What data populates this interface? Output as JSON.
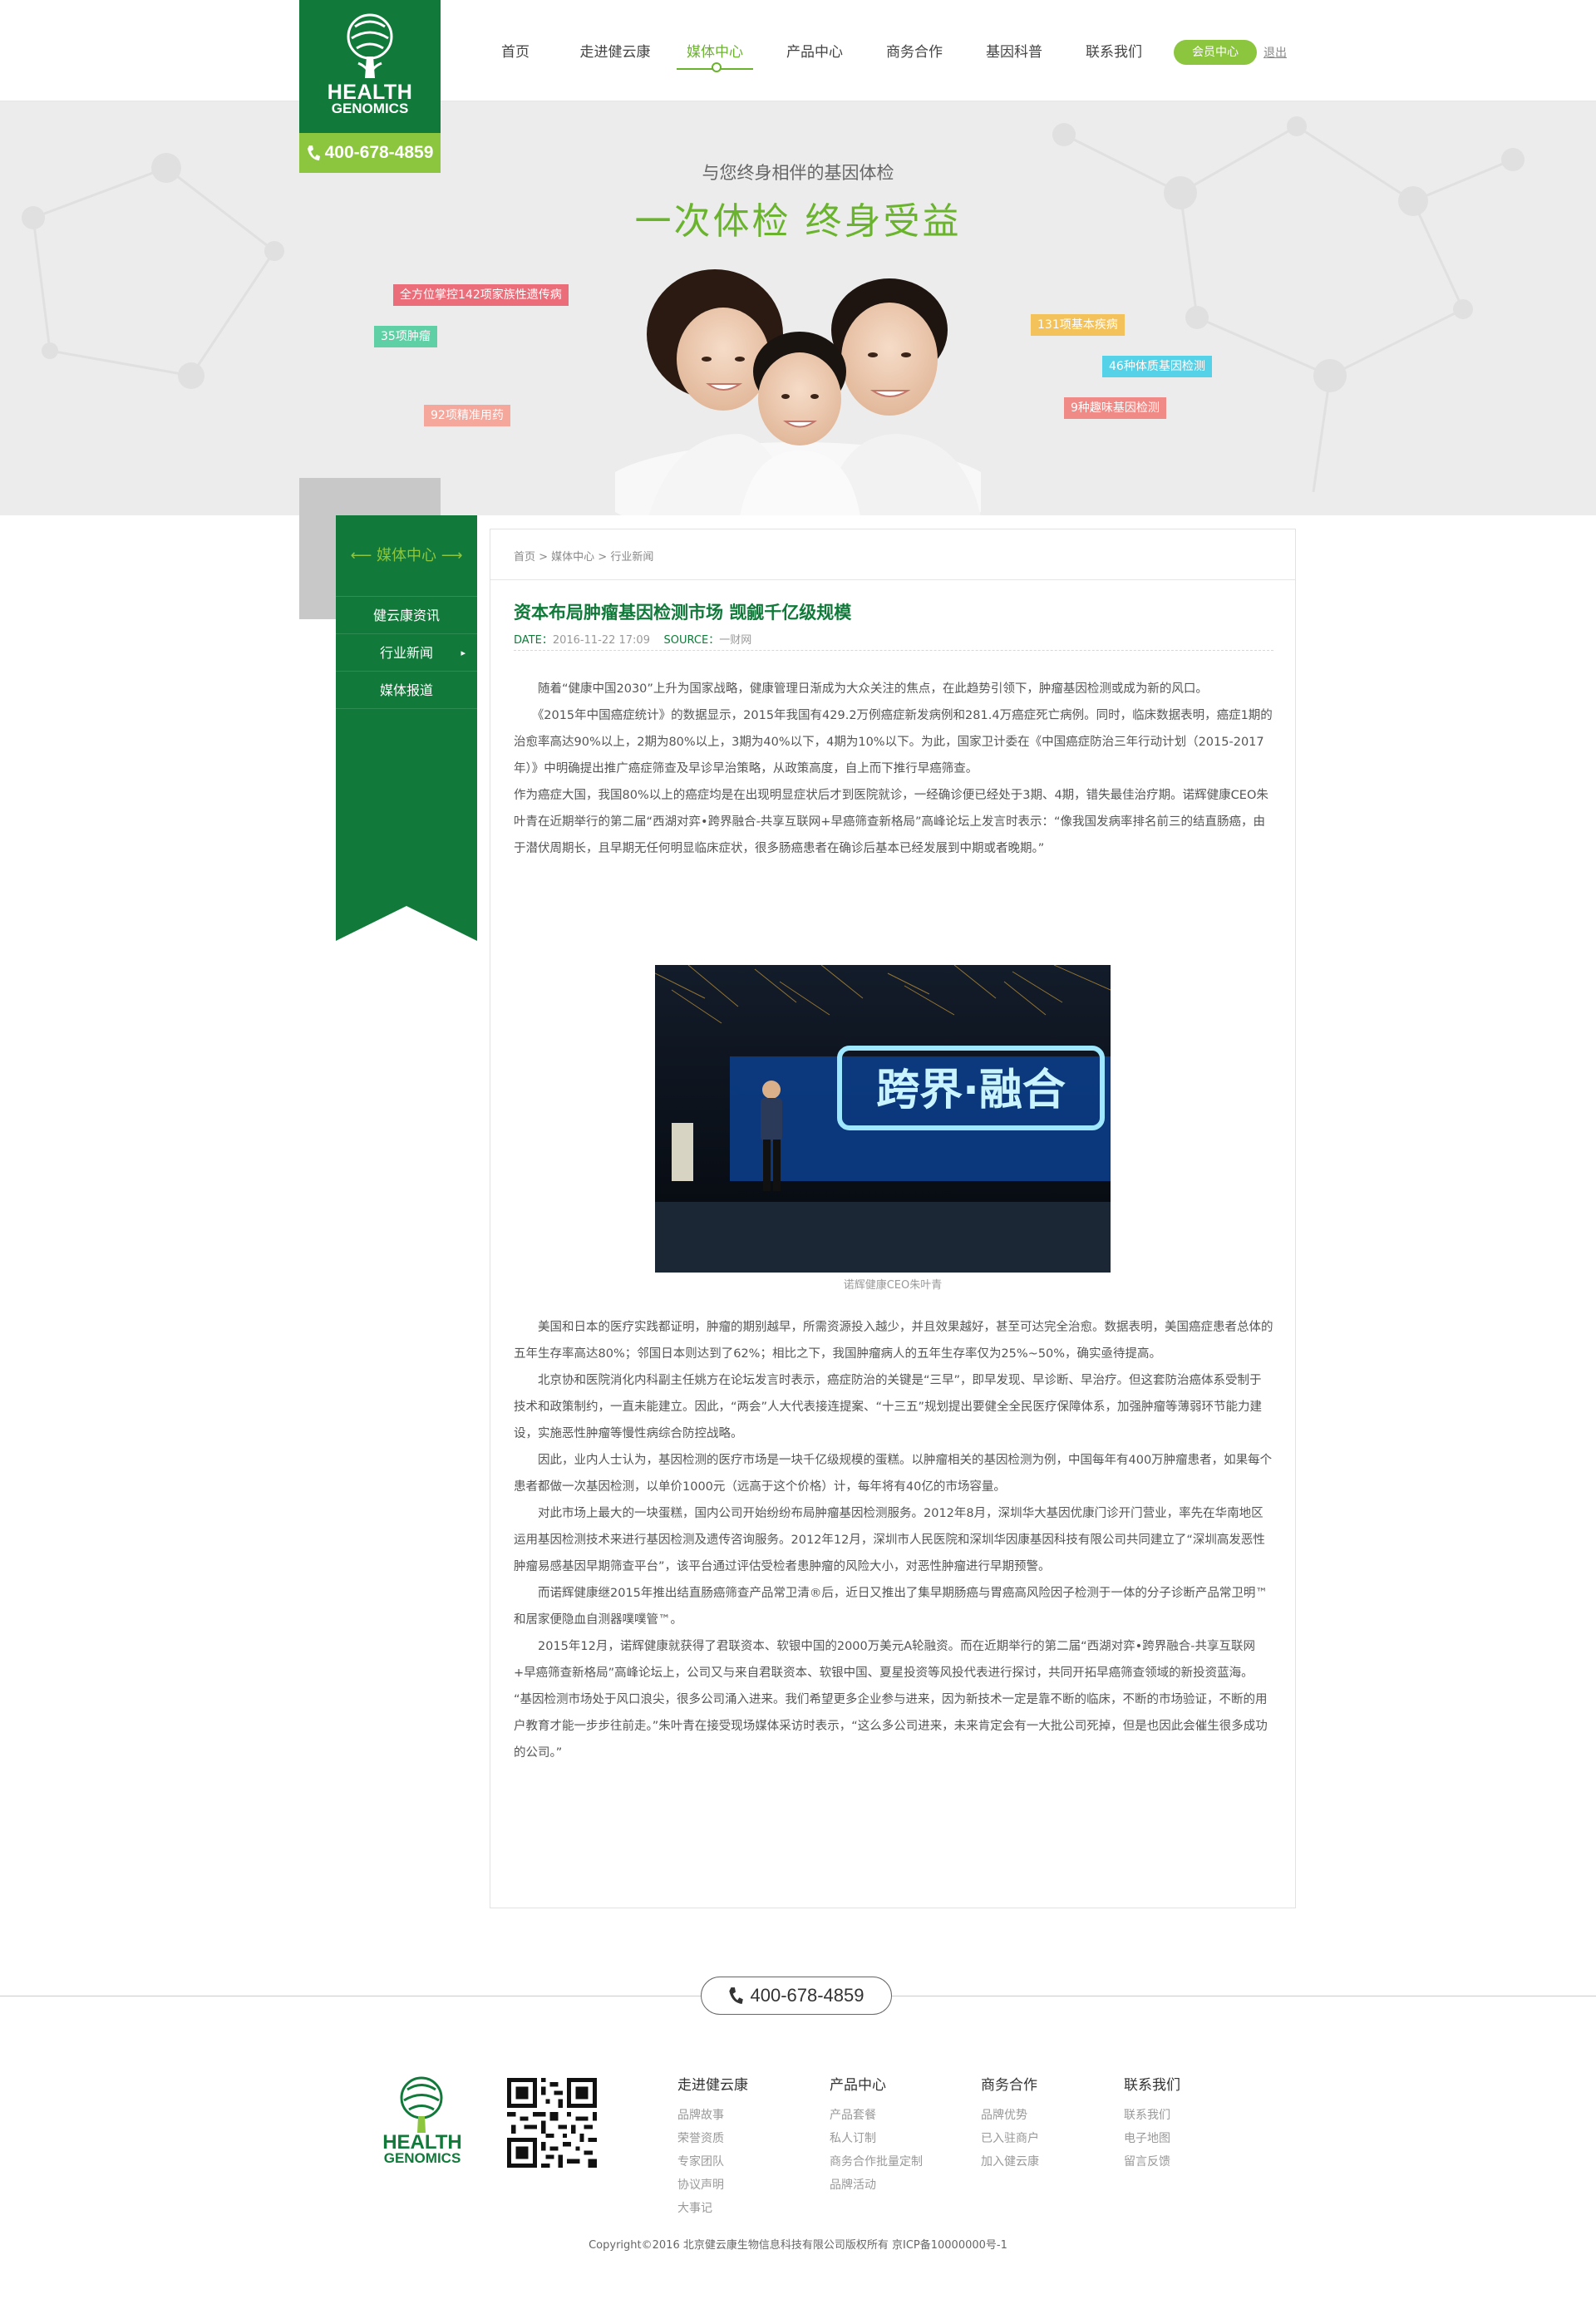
{
  "brand": {
    "logo_line1": "HEALTH",
    "logo_line2": "GENOMICS",
    "phone": "400-678-4859",
    "green": "#117a3a",
    "light_green": "#8cc63e",
    "accent_green": "#6ab42d"
  },
  "nav": {
    "items": [
      "首页",
      "走进健云康",
      "媒体中心",
      "产品中心",
      "商务合作",
      "基因科普",
      "联系我们"
    ],
    "active_index": 2,
    "member_label": "会员中心",
    "logout_label": "退出"
  },
  "banner": {
    "subtitle": "与您终身相伴的基因体检",
    "title": "一次体检  终身受益",
    "tags": [
      {
        "text": "全方位掌控142项家族性遗传病",
        "color": "#ec6d7a"
      },
      {
        "text": "35项肿瘤",
        "color": "#5fcfa6"
      },
      {
        "text": "92项精准用药",
        "color": "#f5a79c"
      },
      {
        "text": "131项基本疾病",
        "color": "#f3c25a"
      },
      {
        "text": "46种体质基因检测",
        "color": "#56d2e8"
      },
      {
        "text": "9种趣味基因检测",
        "color": "#f08a86"
      }
    ]
  },
  "sidebar": {
    "title": "媒体中心",
    "items": [
      "健云康资讯",
      "行业新闻",
      "媒体报道"
    ],
    "arrow": "▸"
  },
  "article": {
    "breadcrumb": "首页 > 媒体中心 > 行业新闻",
    "title": "资本布局肿瘤基因检测市场 觊觎千亿级规模",
    "date_label": "DATE：",
    "date": "2016-11-22  17:09",
    "source_label": "SOURCE：",
    "source": "一财网",
    "paragraphs_top": [
      "　　随着“健康中国2030”上升为国家战略，健康管理日渐成为大众关注的焦点，在此趋势引领下，肿瘤基因检测或成为新的风口。",
      "　　《2015年中国癌症统计》的数据显示，2015年我国有429.2万例癌症新发病例和281.4万癌症死亡病例。同时，临床数据表明，癌症1期的治愈率高达90%以上，2期为80%以上，3期为40%以下，4期为10%以下。为此，国家卫计委在《中国癌症防治三年行动计划（2015-2017年）》中明确提出推广癌症筛查及早诊早治策略，从政策高度，自上而下推行早癌筛查。",
      "作为癌症大国，我国80%以上的癌症均是在出现明显症状后才到医院就诊，一经确诊便已经处于3期、4期，错失最佳治疗期。诺辉健康CEO朱叶青在近期举行的第二届“西湖对弈•跨界融合-共享互联网+早癌筛查新格局”高峰论坛上发言时表示：“像我国发病率排名前三的结直肠癌，由于潜伏周期长，且早期无任何明显临床症状，很多肠癌患者在确诊后基本已经发展到中期或者晚期。”"
    ],
    "photo_text": "跨界·融合",
    "photo_caption": "诺辉健康CEO朱叶青",
    "paragraphs_bottom": [
      "　　美国和日本的医疗实践都证明，肿瘤的期别越早，所需资源投入越少，并且效果越好，甚至可达完全治愈。数据表明，美国癌症患者总体的五年生存率高达80%；邻国日本则达到了62%；相比之下，我国肿瘤病人的五年生存率仅为25%~50%，确实亟待提高。",
      "　　北京协和医院消化内科副主任姚方在论坛发言时表示，癌症防治的关键是“三早”，即早发现、早诊断、早治疗。但这套防治癌体系受制于技术和政策制约，一直未能建立。因此，“两会”人大代表接连提案、“十三五”规划提出要健全全民医疗保障体系，加强肿瘤等薄弱环节能力建设，实施恶性肿瘤等慢性病综合防控战略。",
      "　　因此，业内人士认为，基因检测的医疗市场是一块千亿级规模的蛋糕。以肿瘤相关的基因检测为例，中国每年有400万肿瘤患者，如果每个患者都做一次基因检测，以单价1000元（远高于这个价格）计，每年将有40亿的市场容量。",
      "　　对此市场上最大的一块蛋糕，国内公司开始纷纷布局肿瘤基因检测服务。2012年8月，深圳华大基因优康门诊开门营业，率先在华南地区运用基因检测技术来进行基因检测及遗传咨询服务。2012年12月，深圳市人民医院和深圳华因康基因科技有限公司共同建立了“深圳高发恶性肿瘤易感基因早期筛查平台”，该平台通过评估受检者患肿瘤的风险大小，对恶性肿瘤进行早期预警。",
      "　　而诺辉健康继2015年推出结直肠癌筛查产品常卫清®后，近日又推出了集早期肠癌与胃癌高风险因子检测于一体的分子诊断产品常卫明™和居家便隐血自测器噗噗管™。",
      "　　2015年12月，诺辉健康就获得了君联资本、软银中国的2000万美元A轮融资。而在近期举行的第二届“西湖对弈•跨界融合-共享互联网+早癌筛查新格局”高峰论坛上，公司又与来自君联资本、软银中国、夏星投资等风投代表进行探讨，共同开拓早癌筛查领域的新投资蓝海。",
      "“基因检测市场处于风口浪尖，很多公司涌入进来。我们希望更多企业参与进来，因为新技术一定是靠不断的临床，不断的市场验证，不断的用户教育才能一步步往前走。”朱叶青在接受现场媒体采访时表示，“这么多公司进来，未来肯定会有一大批公司死掉，但是也因此会催生很多成功的公司。”"
    ]
  },
  "footer": {
    "phone": "400-678-4859",
    "columns": [
      {
        "title": "走进健云康",
        "items": [
          "品牌故事",
          "荣誉资质",
          "专家团队",
          "协议声明",
          "大事记"
        ]
      },
      {
        "title": "产品中心",
        "items": [
          "产品套餐",
          "私人订制",
          "商务合作批量定制",
          "品牌活动"
        ]
      },
      {
        "title": "商务合作",
        "items": [
          "品牌优势",
          "已入驻商户",
          "加入健云康"
        ]
      },
      {
        "title": "联系我们",
        "items": [
          "联系我们",
          "电子地图",
          "留言反馈"
        ]
      }
    ],
    "copyright": "Copyright©2016 北京健云康生物信息科技有限公司版权所有  京ICP备10000000号-1"
  }
}
